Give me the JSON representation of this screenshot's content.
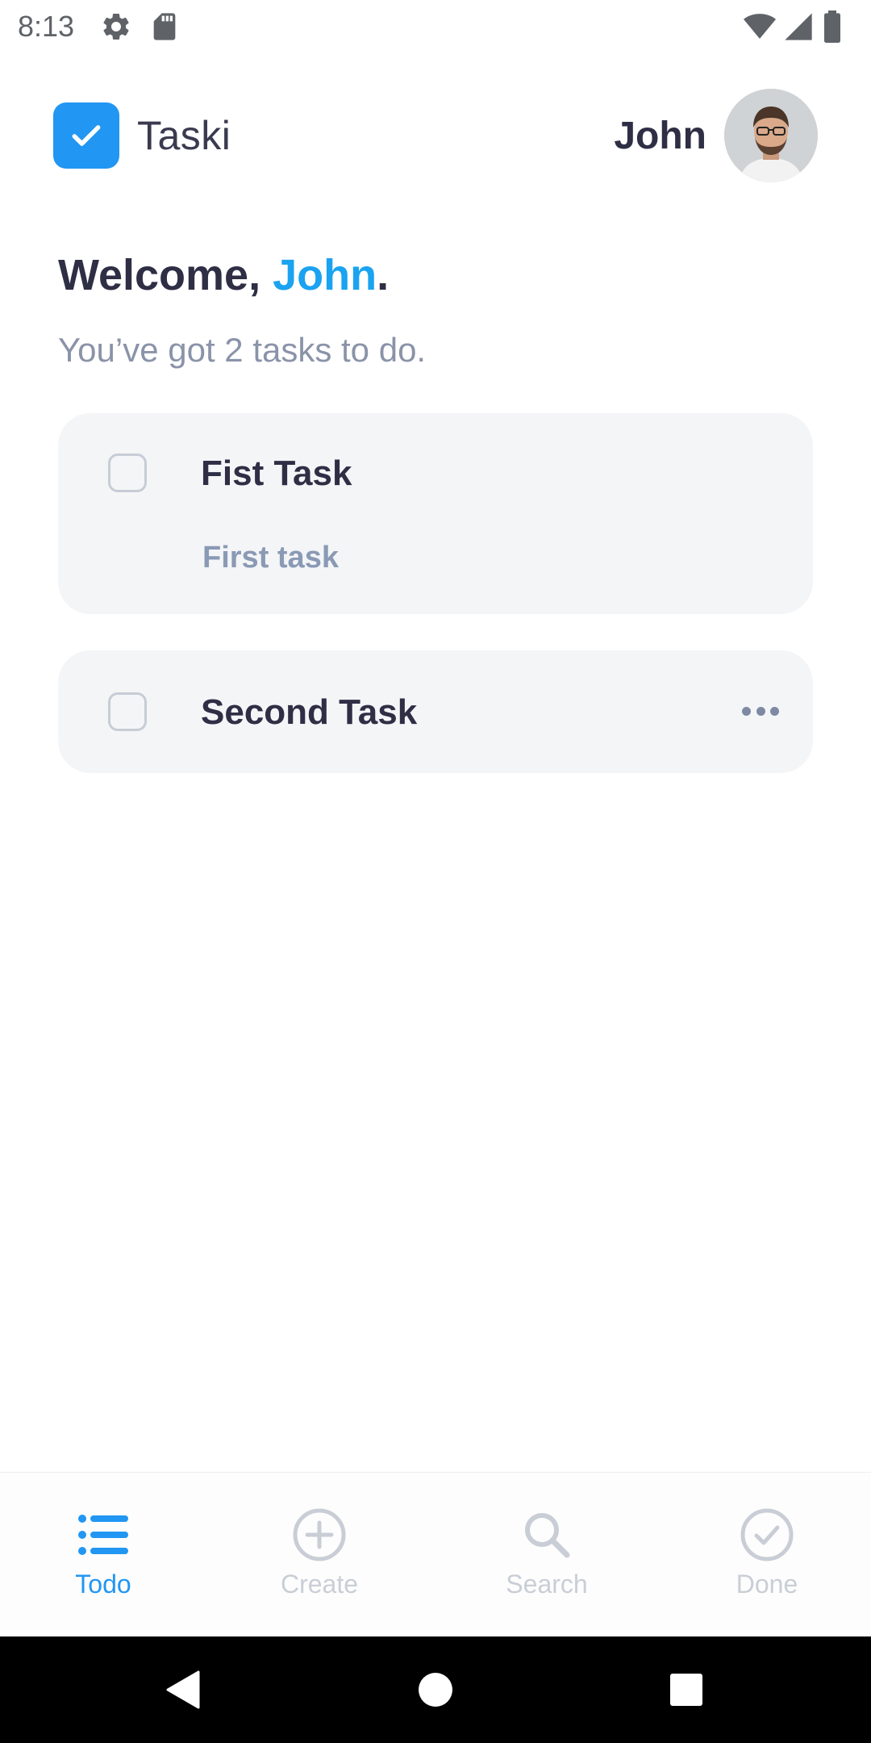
{
  "status_bar": {
    "time": "8:13",
    "icons": [
      "gear-icon",
      "sd-card-icon",
      "wifi-icon",
      "signal-icon",
      "battery-icon"
    ]
  },
  "header": {
    "app_name": "Taski",
    "user_name": "John",
    "logo_color": "#2196f3"
  },
  "welcome": {
    "prefix": "Welcome, ",
    "name": "John",
    "suffix": ".",
    "subtitle": "You’ve got 2 tasks to do.",
    "accent_color": "#1aa3f0"
  },
  "tasks": [
    {
      "title": "Fist Task",
      "description": "First task",
      "done": false
    },
    {
      "title": "Second Task",
      "description": "",
      "done": false
    }
  ],
  "bottom_nav": {
    "items": [
      {
        "label": "Todo",
        "icon": "list-icon",
        "active": true
      },
      {
        "label": "Create",
        "icon": "plus-circle-icon",
        "active": false
      },
      {
        "label": "Search",
        "icon": "search-icon",
        "active": false
      },
      {
        "label": "Done",
        "icon": "check-circle-icon",
        "active": false
      }
    ],
    "active_color": "#2196f3",
    "inactive_color": "#c9ced6"
  },
  "system_nav": {
    "icons": [
      "back-icon",
      "home-icon",
      "recents-icon"
    ]
  }
}
